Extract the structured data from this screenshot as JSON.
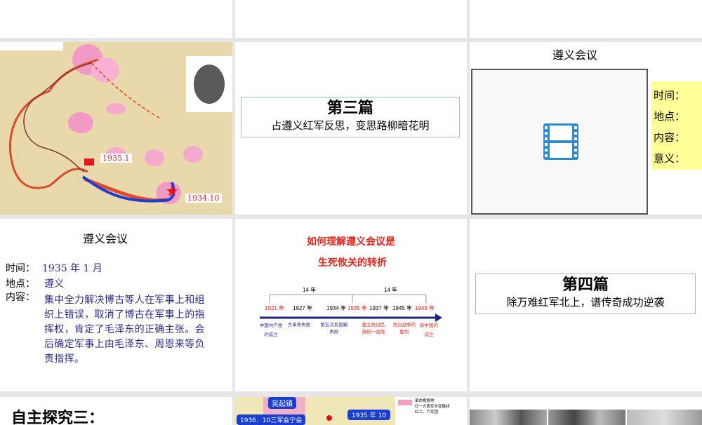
{
  "slides": [
    {
      "id": "map-1934"
    },
    {
      "title": "第三篇",
      "subtitle": "占遵义红军反思，变思路柳暗花明"
    },
    {
      "title": "遵义会议",
      "labels": [
        "时间：",
        "地点：",
        "内容：",
        "意义："
      ],
      "media": "film-icon"
    },
    {
      "title": "遵义会议",
      "time_label": "时间：",
      "time_value": "1935 年 1 月",
      "place_label": "地点：",
      "place_value": "遵义",
      "content_label": "内容：",
      "content_value": "集中全力解决博古等人在军事上和组织上错误，取消了博古在军事上的指挥权，肯定了毛泽东的正确主张。会后确定军事上由毛泽东、周恩来等负责指挥。"
    },
    {
      "title_line1": "如何理解遵义会议是",
      "title_line2": "生死攸关的转折",
      "span1": "14 年",
      "span2": "14 年",
      "years": [
        {
          "y": "1921 年",
          "red": true,
          "ev": "中国共产党的成立"
        },
        {
          "y": "1927 年",
          "red": false,
          "ev": "大革命失败"
        },
        {
          "y": "1934 年",
          "red": false,
          "ev": "第五次反围剿失败"
        },
        {
          "y": "1935 年",
          "red": true,
          "ev": ""
        },
        {
          "y": "1937 年",
          "red": false,
          "ev": "建立抗日民族统一战线"
        },
        {
          "y": "1945 年",
          "red": false,
          "ev": "抗日战争的胜利"
        },
        {
          "y": "1949 年",
          "red": true,
          "ev": "新中国的成立"
        }
      ]
    },
    {
      "title": "第四篇",
      "subtitle": "除万难红军北上，谱传奇成功逆袭"
    },
    {
      "title": "自主探究三："
    },
    {
      "labels": [
        "吴起镇",
        "1936．10三军会宁会",
        "1935 年 10"
      ],
      "legend": [
        "革命根据地",
        "红一方面军长征路线",
        "红二、六军团"
      ]
    },
    {
      "id": "photos"
    }
  ],
  "map_labels": {
    "start": "1934.10",
    "zunyi": "1935.1"
  },
  "colors": {
    "accent_green": "#9fc89f",
    "yellow_box": "#ffff99",
    "route_red": "#e0402a",
    "route_blue": "#1a3fd0"
  }
}
